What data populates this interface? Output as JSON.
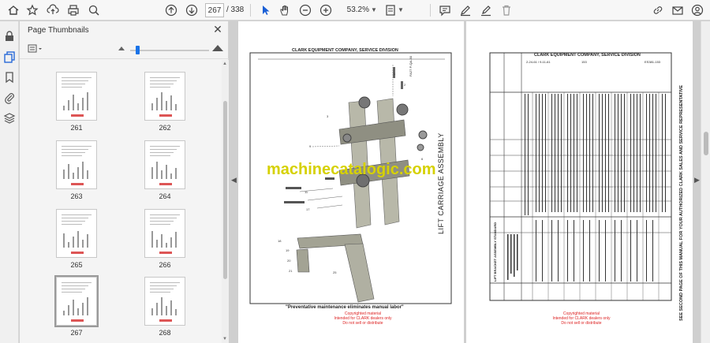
{
  "toolbar": {
    "current_page": "267",
    "total_pages": "/ 338",
    "zoom": "53.2%",
    "icons": [
      "home-icon",
      "bookmark-star-icon",
      "upload-icon",
      "print-icon",
      "zoom-search-icon",
      "page-up-icon",
      "page-down-icon",
      "select-cursor-icon",
      "hand-icon",
      "zoom-out-icon",
      "zoom-in-icon",
      "fit-page-icon",
      "comment-icon",
      "pen-icon",
      "highlight-icon",
      "delete-icon",
      "link-icon",
      "email-icon",
      "account-icon"
    ]
  },
  "sidebar_panel": {
    "title": "Page Thumbnails",
    "close": "✕",
    "thumbnails": [
      {
        "label": "261"
      },
      {
        "label": "262"
      },
      {
        "label": "263"
      },
      {
        "label": "264"
      },
      {
        "label": "265"
      },
      {
        "label": "266"
      },
      {
        "label": "267"
      },
      {
        "label": "268"
      }
    ]
  },
  "rail": {
    "icons": [
      "lock-icon",
      "page-thumbnails-icon",
      "bookmark-icon",
      "attachment-icon",
      "layers-icon"
    ]
  },
  "document": {
    "left_page": {
      "header": "CLARK EQUIPMENT COMPANY, SERVICE DIVISION",
      "side_code": "FA27 P-QA-30",
      "vertical_title": "LIFT CARRIAGE ASSEMBLY",
      "footer": "\"Preventative maintenance eliminates manual labor\"",
      "copyright": [
        "Copyrighted material",
        "Intended for CLARK dealers only",
        "Do not sell or distribute"
      ]
    },
    "right_page": {
      "header": "CLARK EQUIPMENT COMPANY, SERVICE DIVISION",
      "header_sub_left": "2-24-61 / 9-11-61",
      "header_sub_mid": "153",
      "header_code": "ES381-153",
      "side_banner": "SEE SECOND PAGE OF THIS MANUAL FOR YOUR AUTHORIZED CLARK SALES AND SERVICE REPRESENTATIVE",
      "table_label_lift": "LIFT BRACKET ASSEMBLY STANDARD",
      "copyright": [
        "Copyrighted material",
        "Intended for CLARK dealers only",
        "Do not sell or distribute"
      ]
    },
    "watermark": "machinecatalogic.com"
  }
}
